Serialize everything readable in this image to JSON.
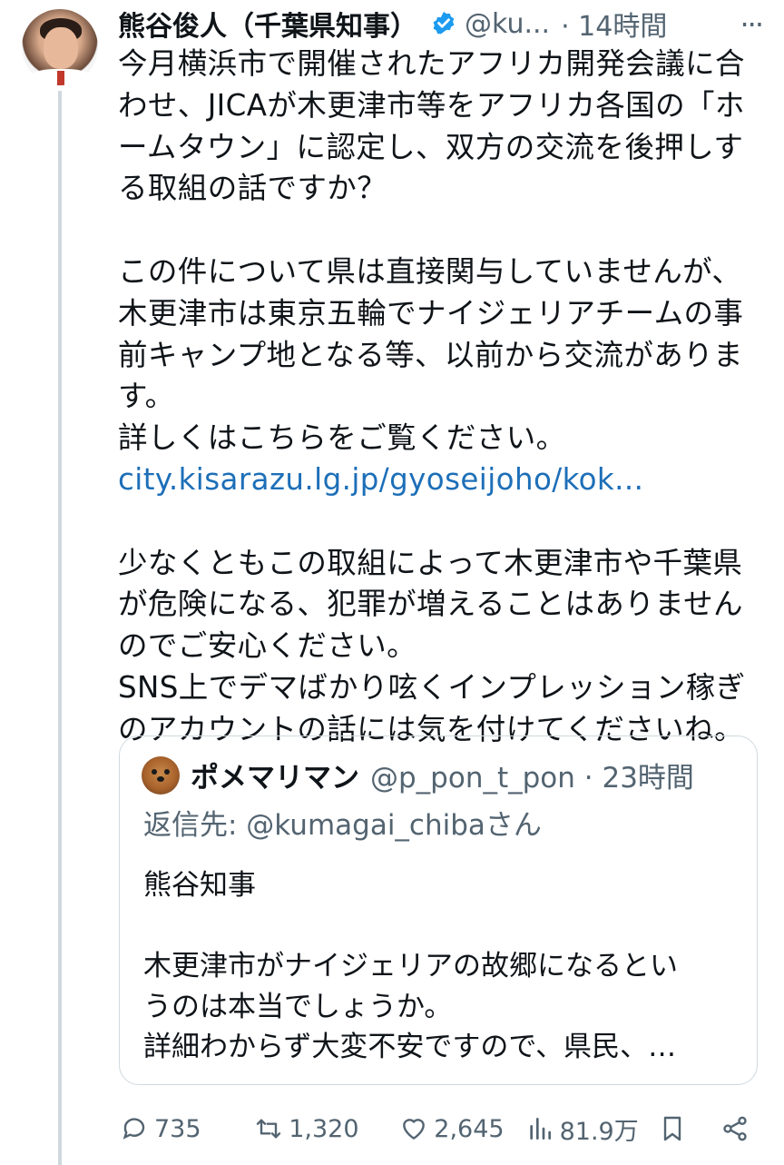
{
  "tweet": {
    "author_name": "熊谷俊人（千葉県知事）",
    "handle": "@ku...",
    "time": "· 14時間",
    "more": "···",
    "body_part1": "今月横浜市で開催されたアフリカ開発会議に合\nわせ、JICAが木更津市等をアフリカ各国の「ホ\nームタウン」に認定し、双方の交流を後押しす\nる取組の話ですか？\n\nこの件について県は直接関与していませんが、\n木更津市は東京五輪でナイジェリアチームの事\n前キャンプ地となる等、以前から交流がありま\nす。\n詳しくはこちらをご覧ください。\n",
    "link": "city.kisarazu.lg.jp/gyoseijoho/kok...",
    "body_part2": "\n\n少なくともこの取組によって木更津市や千葉県\nが危険になる、犯罪が増えることはありません\nのでご安心ください。\nSNS上でデマばかり呟くインプレッション稼ぎ\nのアカウントの話には気を付けてくださいね。"
  },
  "quote": {
    "author_name": "ポメマリマン",
    "handle_time": "@p_pon_t_pon · 23時間",
    "reply_to": "返信先: @kumagai_chibaさん",
    "body": "熊谷知事\n\n木更津市がナイジェリアの故郷になるとい\nうのは本当でしょうか。\n詳細わからず大変不安ですので、県民、…"
  },
  "actions": {
    "replies": "735",
    "retweets": "1,320",
    "likes": "2,645",
    "views": "81.9万"
  },
  "colors": {
    "link": "#1d6fb8",
    "verified": "#1d9bf0",
    "muted": "#536471"
  },
  "icons": [
    "verified-badge-icon",
    "more-icon",
    "reply-icon",
    "retweet-icon",
    "like-icon",
    "views-icon",
    "bookmark-icon",
    "share-icon"
  ]
}
